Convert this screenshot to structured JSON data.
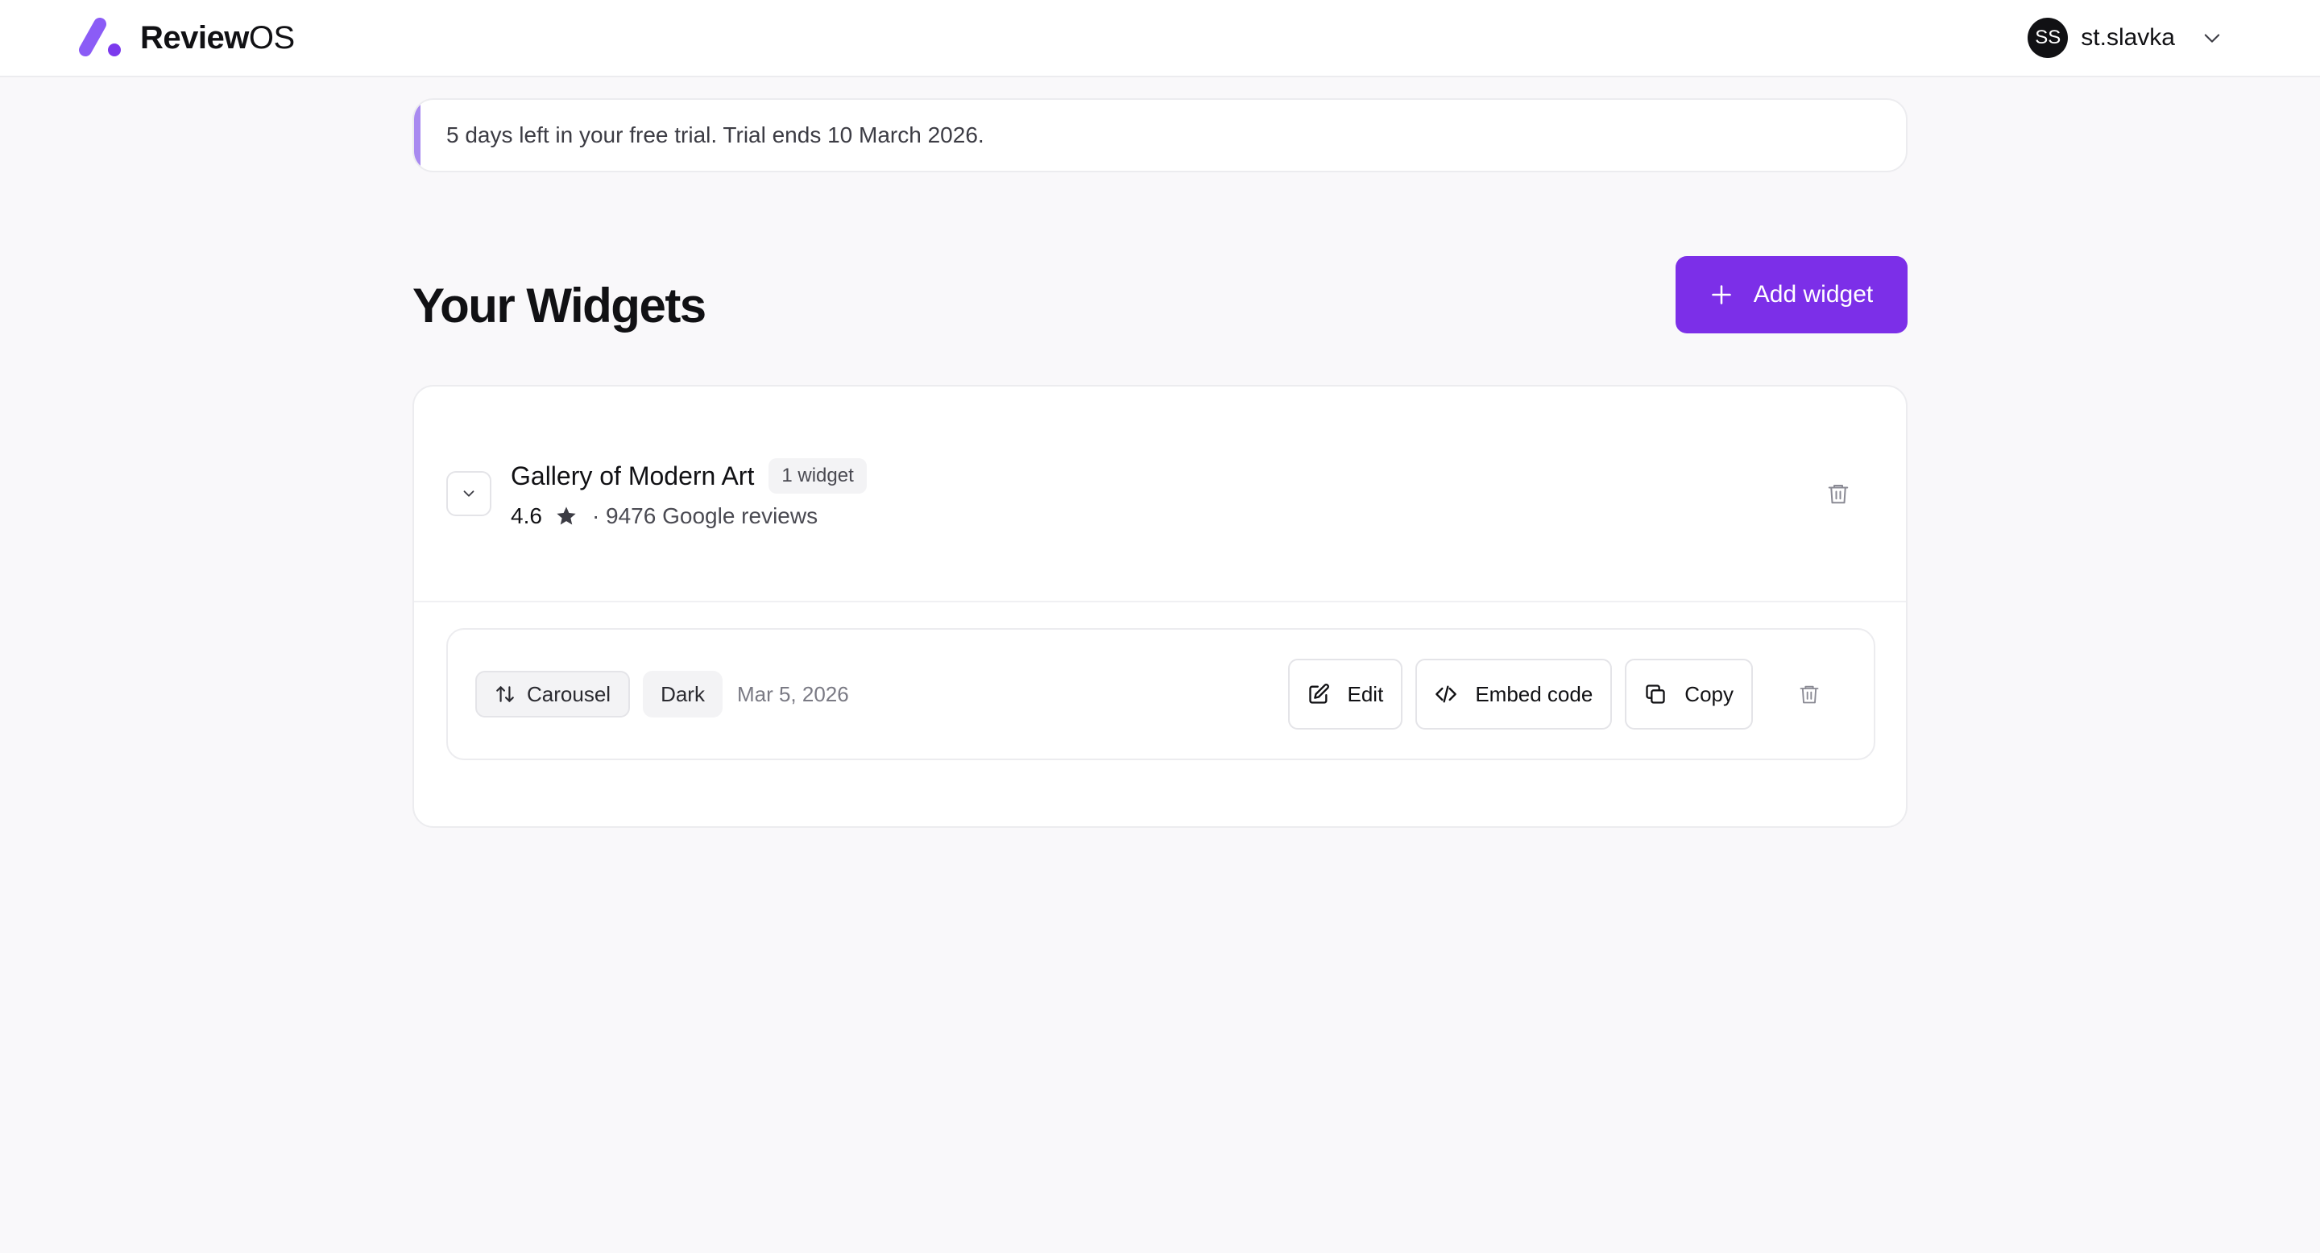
{
  "header": {
    "brand": {
      "name_bold": "Review",
      "name_light": "OS",
      "logo_color": "#8b5cf6"
    },
    "user": {
      "initials": "SS",
      "username": "st.slavka"
    }
  },
  "trial_banner": {
    "text": "5 days left in your free trial. Trial ends 10 March 2026.",
    "accent_color": "#a98af0"
  },
  "page": {
    "title": "Your Widgets",
    "add_button_label": "Add widget",
    "accent_color": "#7c2fe8"
  },
  "locations": [
    {
      "name": "Gallery of Modern Art",
      "widget_count": "1 widget",
      "rating": "4.6",
      "reviews_text": "· 9476 Google reviews",
      "widgets": [
        {
          "layout": "Carousel",
          "theme": "Dark",
          "date": "Mar 5, 2026",
          "actions": {
            "edit": "Edit",
            "embed": "Embed code",
            "copy": "Copy"
          }
        }
      ]
    }
  ],
  "icons": {
    "logo": "reviewos-logo-icon",
    "chevron": "chevron-down-icon",
    "plus": "plus-icon",
    "star": "star-icon",
    "trash": "trash-icon",
    "layout": "swap-arrows-icon",
    "edit": "edit-icon",
    "embed": "code-icon",
    "copy": "copy-icon"
  }
}
